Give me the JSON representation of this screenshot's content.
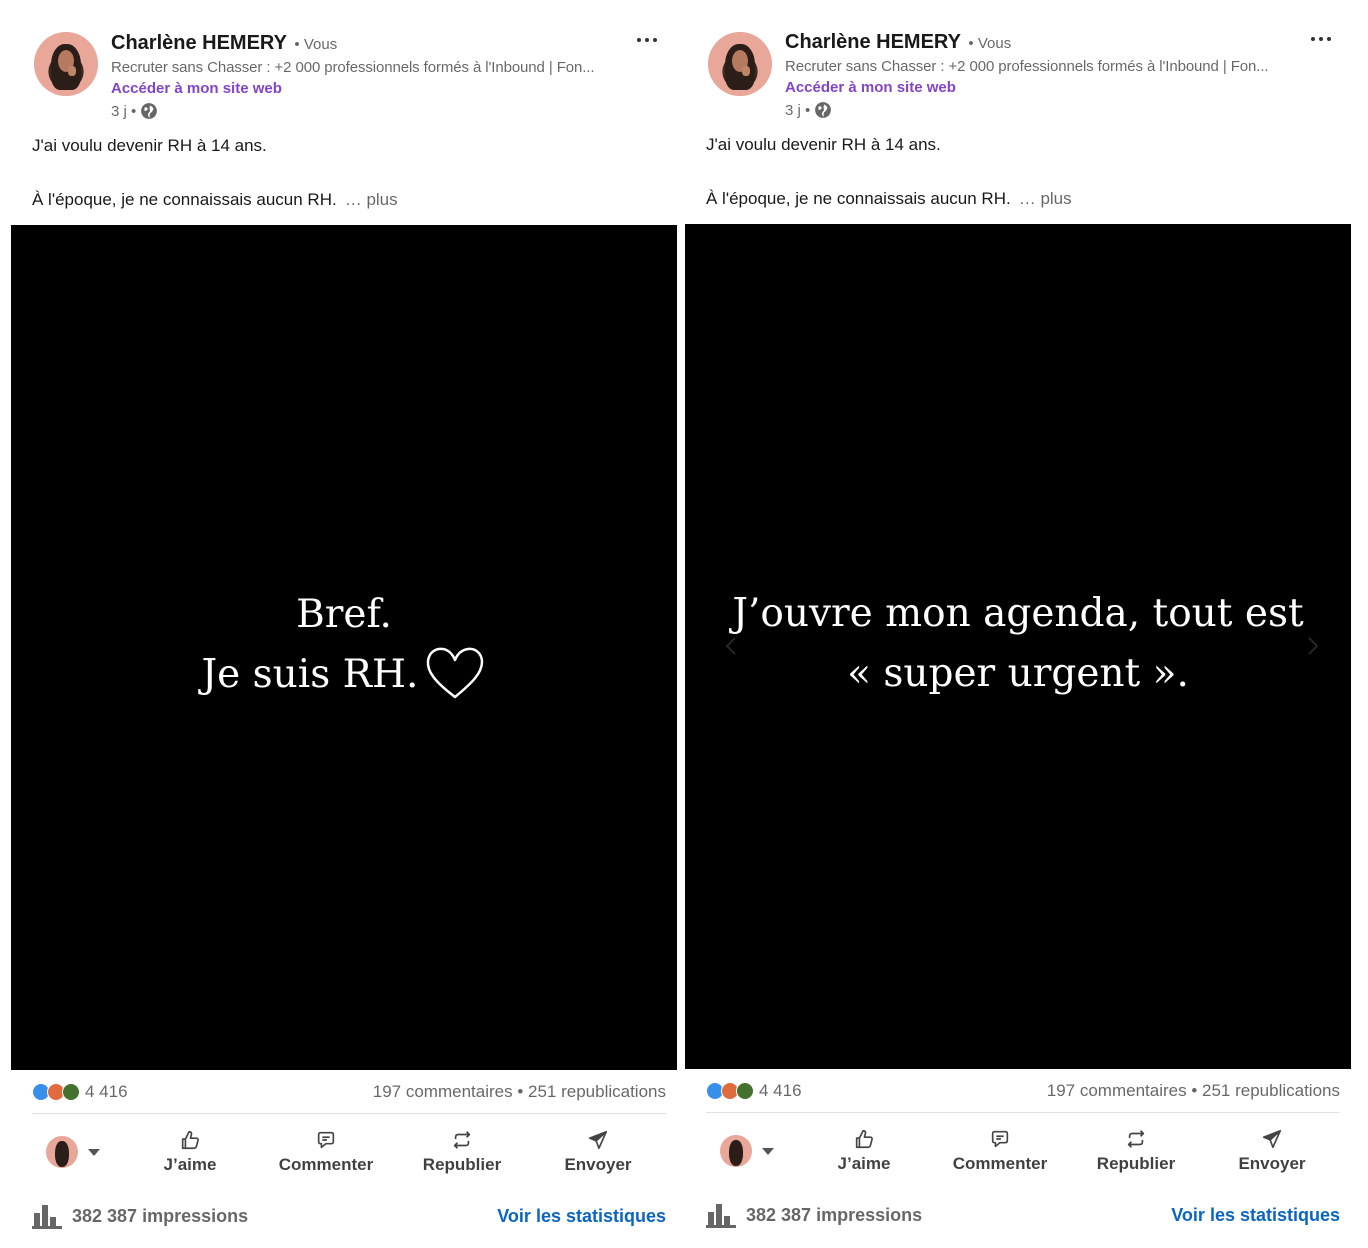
{
  "posts": [
    {
      "author": {
        "name": "Charlène HEMERY",
        "degree": "• Vous",
        "headline": "Recruter sans Chasser : +2 000 professionnels formés à l'Inbound | Fon...",
        "website_link": "Accéder à mon site web",
        "time": "3 j •",
        "visibility_icon": "globe-icon"
      },
      "more_icon": "ellipsis-icon",
      "text": {
        "line1": "J'ai voulu devenir RH à 14 ans.",
        "line2": "À l'époque, je ne connaissais aucun RH.",
        "see_more": "… plus"
      },
      "slide": {
        "line1": "Bref.",
        "line2": "Je suis RH.",
        "decoration": "heart-icon"
      },
      "reactions": {
        "count": "4 416",
        "icons": [
          "like-icon",
          "celebrate-icon",
          "support-icon"
        ]
      },
      "social_counts": "197 commentaires • 251 republications",
      "actions": {
        "like": "J’aime",
        "comment": "Commenter",
        "repost": "Republier",
        "send": "Envoyer"
      },
      "impressions": "382 387 impressions",
      "stats_link": "Voir les statistiques"
    },
    {
      "author": {
        "name": "Charlène HEMERY",
        "degree": "• Vous",
        "headline": "Recruter sans Chasser : +2 000 professionnels formés à l'Inbound | Fon...",
        "website_link": "Accéder à mon site web",
        "time": "3 j •",
        "visibility_icon": "globe-icon"
      },
      "more_icon": "ellipsis-icon",
      "text": {
        "line1": "J'ai voulu devenir RH à 14 ans.",
        "line2": "À l'époque, je ne connaissais aucun RH.",
        "see_more": "… plus"
      },
      "slide": {
        "line1": "J’ouvre mon agenda, tout est",
        "line2": "« super urgent ».",
        "carousel_controls": [
          "chevron-left-icon",
          "chevron-right-icon"
        ]
      },
      "reactions": {
        "count": "4 416",
        "icons": [
          "like-icon",
          "celebrate-icon",
          "support-icon"
        ]
      },
      "social_counts": "197 commentaires • 251 republications",
      "actions": {
        "like": "J’aime",
        "comment": "Commenter",
        "repost": "Republier",
        "send": "Envoyer"
      },
      "impressions": "382 387 impressions",
      "stats_link": "Voir les statistiques"
    }
  ],
  "colors": {
    "link_purple": "#8344cc",
    "link_blue": "#0a66c2",
    "media_background": "#000000",
    "react_like": "#378fe9",
    "react_celebrate": "#e06b3f",
    "react_support": "#44712e"
  }
}
